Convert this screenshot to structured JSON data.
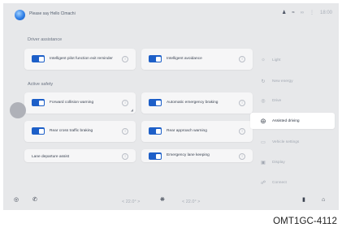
{
  "status_bar": {
    "voice_prompt": "Please say Hello Clmachi",
    "icons": [
      "person-icon",
      "wifi-icon",
      "bluetooth-icon",
      "signal-icon",
      "time"
    ],
    "time": "18:00"
  },
  "sections": {
    "driver_assistance": "Driver assistance",
    "active_safety": "Active safety"
  },
  "cards": [
    {
      "label": "Intelligent pilot function exit reminder",
      "on": true
    },
    {
      "label": "Intelligent avoidance",
      "on": true
    },
    {
      "label": "Forward collision warning",
      "on": true
    },
    {
      "label": "Automatic emergency braking",
      "on": true
    },
    {
      "label": "Rear cross traffic braking",
      "on": true
    },
    {
      "label": "Rear approach warning",
      "on": true
    },
    {
      "label": "Lane departure assist",
      "on": true
    },
    {
      "label": "Emergency lane keeping",
      "on": true
    }
  ],
  "menu": [
    {
      "label": "Light",
      "icon": "light-icon"
    },
    {
      "label": "New energy",
      "icon": "energy-icon"
    },
    {
      "label": "Drive",
      "icon": "drive-icon"
    },
    {
      "label": "Assisted driving",
      "icon": "steering-icon",
      "active": true
    },
    {
      "label": "Vehicle settings",
      "icon": "car-icon"
    },
    {
      "label": "Display",
      "icon": "display-icon"
    },
    {
      "label": "Connect",
      "icon": "connect-icon"
    }
  ],
  "bottom_bar": {
    "left_temp": "< 22.0° >",
    "right_temp": "< 22.0° >"
  },
  "caption": "OMT1GC-4112",
  "colors": {
    "toggle_on": "#1d5fc8",
    "background": "#e7e8ea",
    "card": "#f6f6f7"
  }
}
